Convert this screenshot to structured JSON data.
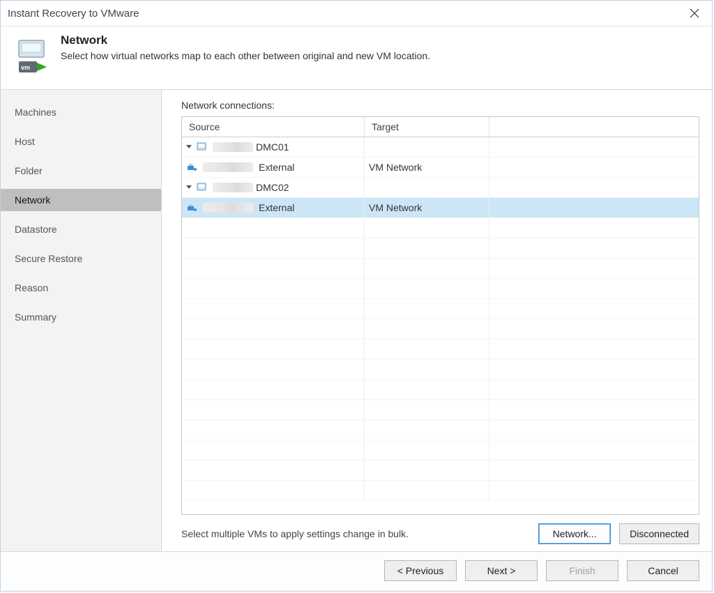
{
  "window": {
    "title": "Instant Recovery to VMware"
  },
  "header": {
    "heading": "Network",
    "subheading": "Select how virtual networks map to each other between original and new VM location."
  },
  "sidebar": {
    "items": [
      {
        "label": "Machines",
        "selected": false
      },
      {
        "label": "Host",
        "selected": false
      },
      {
        "label": "Folder",
        "selected": false
      },
      {
        "label": "Network",
        "selected": true
      },
      {
        "label": "Datastore",
        "selected": false
      },
      {
        "label": "Secure Restore",
        "selected": false
      },
      {
        "label": "Reason",
        "selected": false
      },
      {
        "label": "Summary",
        "selected": false
      }
    ]
  },
  "table": {
    "label": "Network connections:",
    "columns": {
      "source": "Source",
      "target": "Target"
    },
    "rows": [
      {
        "kind": "vm",
        "indent": 1,
        "source_suffix": "DMC01",
        "target": "",
        "selected": false
      },
      {
        "kind": "network",
        "indent": 2,
        "name": "External",
        "target": "VM Network",
        "selected": false
      },
      {
        "kind": "vm",
        "indent": 1,
        "source_suffix": "DMC02",
        "target": "",
        "selected": false
      },
      {
        "kind": "network",
        "indent": 2,
        "name": "External",
        "target": "VM Network",
        "selected": true
      }
    ]
  },
  "bulk_hint": "Select multiple VMs to apply settings change in bulk.",
  "buttons": {
    "network": "Network...",
    "disconnected": "Disconnected",
    "previous": "< Previous",
    "next": "Next >",
    "finish": "Finish",
    "cancel": "Cancel"
  }
}
